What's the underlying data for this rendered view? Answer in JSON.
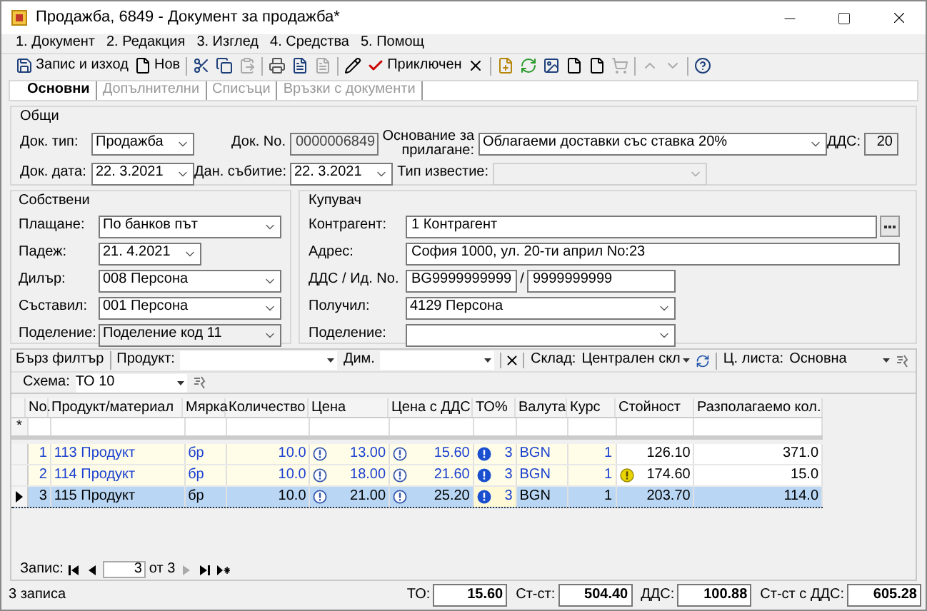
{
  "window": {
    "title": "Продажба, 6849 - Документ за продажба*"
  },
  "menu": [
    "1. Документ",
    "2. Редакция",
    "3. Изглед",
    "4. Средства",
    "5. Помощ"
  ],
  "toolbar": {
    "save_label": "Запис и изход",
    "new_label": "Нов",
    "close_label": "Приключен"
  },
  "tabs": [
    {
      "label": "Основни",
      "selected": true
    },
    {
      "label": "Допълнителни",
      "selected": false
    },
    {
      "label": "Списъци",
      "selected": false
    },
    {
      "label": "Връзки с документи",
      "selected": false
    }
  ],
  "general": {
    "title": "Общи",
    "doc_type": {
      "label": "Док. тип:",
      "value": "Продажба"
    },
    "doc_no": {
      "label": "Док. No.",
      "value": "0000006849"
    },
    "basis": {
      "label": "Основание за прилагане:",
      "value": "Облагаеми доставки със ставка 20%"
    },
    "vat": {
      "label": "ДДС:",
      "value": "20"
    },
    "doc_date": {
      "label": "Док. дата:",
      "value": "22.  3.2021"
    },
    "event_date": {
      "label": "Дан. събитие:",
      "value": "22.  3.2021"
    },
    "notice_type": {
      "label": "Тип известие:",
      "disabled": true
    }
  },
  "own": {
    "title": "Собствени",
    "fields": [
      {
        "label": "Плащане:",
        "value": "По банков път",
        "kind": "combo"
      },
      {
        "label": "Падеж:",
        "value": "21.  4.2021",
        "kind": "date"
      },
      {
        "label": "Дилър:",
        "value": "008 Персона",
        "kind": "combo"
      },
      {
        "label": "Съставил:",
        "value": "001 Персона",
        "kind": "combo"
      },
      {
        "label": "Поделение:",
        "value": "Поделение код 11",
        "kind": "readonly"
      }
    ]
  },
  "buyer": {
    "title": "Купувач",
    "contractor": {
      "label": "Контрагент:",
      "value": "1 Контрагент"
    },
    "address": {
      "label": "Адрес:",
      "value": "София 1000, ул. 20-ти април No:23"
    },
    "vat_id": {
      "label": "ДДС / Ид. No.",
      "value": "BG9999999999",
      "separator": "/",
      "id_value": "9999999999"
    },
    "received": {
      "label": "Получил:",
      "value": "4129 Персона"
    },
    "division": {
      "label": "Поделение:"
    }
  },
  "filter": {
    "quick": "Бърз филтър",
    "product_label": "Продукт:",
    "dim_label": "Дим.",
    "warehouse": {
      "label": "Склад:",
      "value": "Централен скл"
    },
    "price_list": {
      "label": "Ц. листа:",
      "value": "Основна"
    },
    "scheme": {
      "label": "Схема:",
      "value": "ТО 10"
    }
  },
  "table": {
    "columns": [
      "No.",
      "Продукт/материал",
      "Мярка",
      "Количество",
      "Цена",
      "Цена с ДДС",
      "ТО%",
      "Валута",
      "Курс",
      "Стойност",
      "Разполагаемо кол."
    ],
    "new_row_marker": "*",
    "rows": [
      {
        "no": "1",
        "product": "113 Продукт",
        "unit": "бр",
        "qty": "10.0",
        "price": "13.00",
        "price_vat": "15.60",
        "to": "3",
        "currency": "BGN",
        "rate": "1",
        "value": "126.10",
        "available": "371.0",
        "selected": false,
        "warning": false
      },
      {
        "no": "2",
        "product": "114 Продукт",
        "unit": "бр",
        "qty": "10.0",
        "price": "18.00",
        "price_vat": "21.60",
        "to": "3",
        "currency": "BGN",
        "rate": "1",
        "value": "174.60",
        "available": "15.0",
        "selected": false,
        "warning": true
      },
      {
        "no": "3",
        "product": "115 Продукт",
        "unit": "бр",
        "qty": "10.0",
        "price": "21.00",
        "price_vat": "25.20",
        "to": "3",
        "currency": "BGN",
        "rate": "1",
        "value": "203.70",
        "available": "114.0",
        "selected": true,
        "warning": false
      }
    ]
  },
  "navigator": {
    "label": "Запис:",
    "current": "3",
    "total": "от 3"
  },
  "status_bar": {
    "records": "3 записа",
    "totals": [
      {
        "label": "ТО:",
        "value": "15.60"
      },
      {
        "label": "Ст-ст:",
        "value": "504.40"
      },
      {
        "label": "ДДС:",
        "value": "100.88"
      },
      {
        "label": "Ст-ст с ДДС:",
        "value": "605.28"
      }
    ]
  }
}
